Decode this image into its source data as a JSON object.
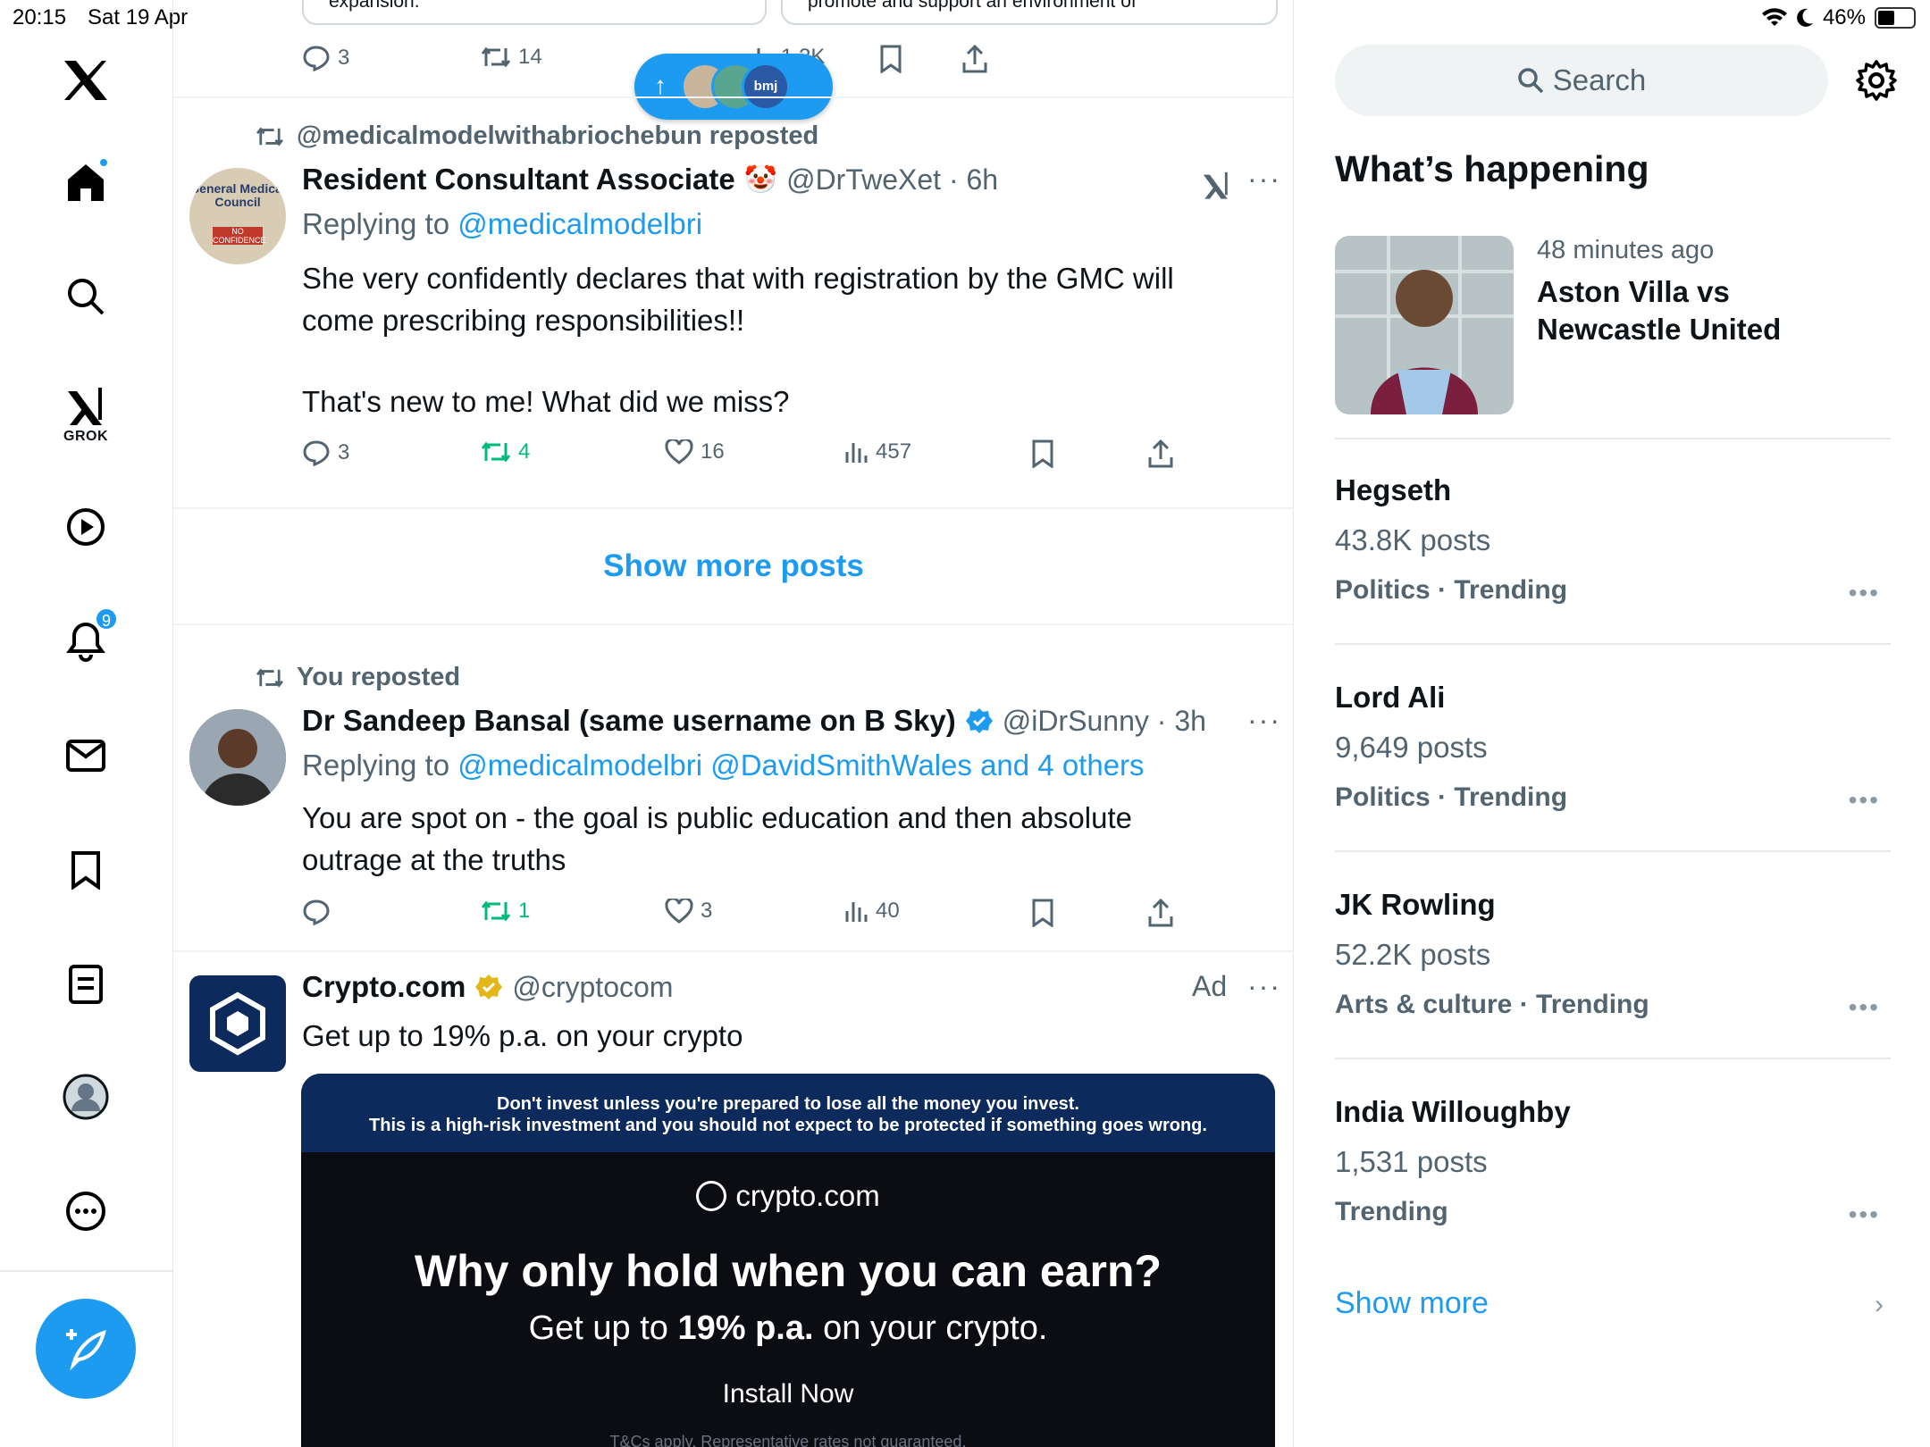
{
  "status_bar": {
    "time": "20:15",
    "date": "Sat 19 Apr",
    "battery": "46%"
  },
  "nav": {
    "grok_label": "GROK",
    "notifications_count": "9",
    "items": [
      "x-logo",
      "home-icon",
      "search-icon",
      "grok-icon",
      "video-icon",
      "notifications-icon",
      "messages-icon",
      "bookmarks-icon",
      "lists-icon",
      "profile-icon",
      "more-icon",
      "compose-icon"
    ]
  },
  "feed": {
    "top_quote_left": "expansion.",
    "top_quote_right": "promote and support an environment of",
    "top_actions": {
      "replies": "3",
      "reposts": "14",
      "views": "1.2K"
    },
    "tweet1": {
      "repost_by": "@medicalmodelwithabriochebun reposted",
      "name": "Resident Consultant Associate",
      "emoji": "🤡",
      "handle_time": "@DrTweXet · 6h",
      "replying_prefix": "Replying to",
      "replying_to": "@medicalmodelbri",
      "text_line1": "She very confidently declares that with registration by the GMC will",
      "text_line2": "come prescribing responsibilities!!",
      "text_line3": "That's new to me! What did we miss?",
      "replies": "3",
      "reposts": "4",
      "likes": "16",
      "views": "457",
      "avatar_text": "General Medical Council",
      "avatar_stamp": "NO CONFIDENCE"
    },
    "show_more_posts": "Show more posts",
    "tweet2": {
      "repost_by": "You reposted",
      "name": "Dr Sandeep Bansal (same username on B Sky)",
      "handle_time": "@iDrSunny · 3h",
      "replying_prefix": "Replying to",
      "replying_to": "@medicalmodelbri @DavidSmithWales and 4 others",
      "text_line1": "You are spot on - the goal is public education and then absolute",
      "text_line2": "outrage at the truths",
      "reposts": "1",
      "likes": "3",
      "views": "40"
    },
    "ad": {
      "name": "Crypto.com",
      "handle": "@cryptocom",
      "ad_label": "Ad",
      "text": "Get up to 19% p.a. on your crypto",
      "warning_line1": "Don't invest unless you're prepared to lose all the money you invest.",
      "warning_line2": "This is a high-risk investment and you should not expect to be protected if something goes wrong.",
      "brand": "crypto.com",
      "headline": "Why only hold when you can earn?",
      "sub_pre": "Get up to ",
      "sub_bold": "19% p.a.",
      "sub_post": " on your crypto.",
      "cta": "Install Now",
      "fine_print": "T&Cs apply. Representative rates not guaranteed."
    },
    "pill_label": "bmj"
  },
  "sidebar": {
    "search_placeholder": "Search",
    "title": "What’s happening",
    "news": {
      "time": "48 minutes ago",
      "title": "Aston Villa vs Newcastle United"
    },
    "trends": [
      {
        "name": "Hegseth",
        "count": "43.8K posts",
        "category": "Politics · Trending"
      },
      {
        "name": "Lord Ali",
        "count": "9,649 posts",
        "category": "Politics · Trending"
      },
      {
        "name": "JK Rowling",
        "count": "52.2K posts",
        "category": "Arts & culture · Trending"
      },
      {
        "name": "India Willoughby",
        "count": "1,531 posts",
        "category": "Trending"
      }
    ],
    "show_more": "Show more"
  },
  "colors": {
    "accent": "#1d9bf0",
    "repost_green": "#00ba7c",
    "muted": "#536471"
  }
}
